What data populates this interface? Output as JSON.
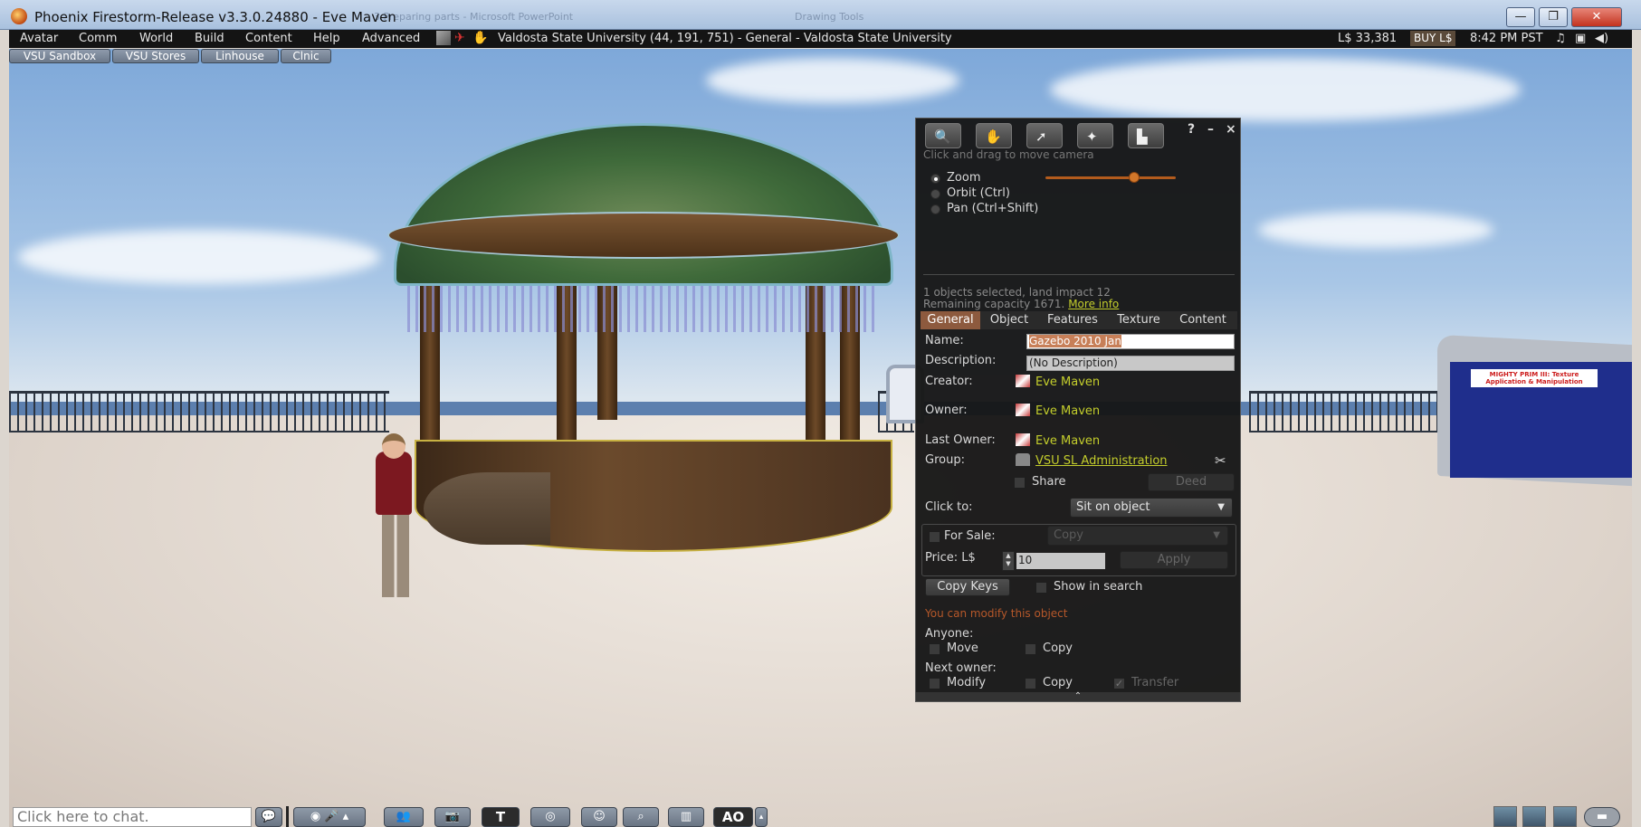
{
  "window": {
    "title": "Phoenix Firestorm-Release v3.3.0.24880 - Eve Maven",
    "ghost_title": "3 Preparing parts - Microsoft PowerPoint",
    "ghost_tab": "Drawing Tools",
    "minimize": "—",
    "maximize": "❐",
    "close": "✕"
  },
  "menu": {
    "items": [
      "Avatar",
      "Comm",
      "World",
      "Build",
      "Content",
      "Help",
      "Advanced"
    ],
    "location": "Valdosta State University (44, 191, 751) - General - Valdosta State University",
    "balance": "L$ 33,381",
    "buy_label": "BUY L$",
    "time": "8:42 PM PST",
    "status_icons": [
      "music-icon",
      "media-icon",
      "volume-icon"
    ]
  },
  "favorites": [
    "VSU Sandbox",
    "VSU Stores",
    "Linhouse",
    "Clnic"
  ],
  "scene": {
    "kiosk_title": "MIGHTY PRIM III: Texture Application & Manipulation"
  },
  "build_panel": {
    "header_controls": {
      "help": "?",
      "minimize": "–",
      "close": "×"
    },
    "tool_icons": [
      "focus-tool-icon",
      "move-tool-icon",
      "edit-tool-icon",
      "create-tool-icon",
      "land-tool-icon"
    ],
    "hint": "Click and drag to move camera",
    "camera_modes": [
      {
        "label": "Zoom",
        "selected": true
      },
      {
        "label": "Orbit (Ctrl)",
        "selected": false
      },
      {
        "label": "Pan (Ctrl+Shift)",
        "selected": false
      }
    ],
    "zoom_level": 0.68,
    "selection_info": "1 objects selected, land impact 12",
    "remaining": "Remaining capacity 1671.",
    "more_info": "More info",
    "tabs": [
      "General",
      "Object",
      "Features",
      "Texture",
      "Content"
    ],
    "active_tab": "General",
    "general": {
      "name_label": "Name:",
      "name_value": "Gazebo 2010 Jan",
      "description_label": "Description:",
      "description_value": "(No Description)",
      "creator_label": "Creator:",
      "creator": "Eve Maven",
      "owner_label": "Owner:",
      "owner": "Eve Maven",
      "last_owner_label": "Last Owner:",
      "last_owner": "Eve Maven",
      "group_label": "Group:",
      "group": "VSU SL Administration",
      "share_label": "Share",
      "deed_label": "Deed",
      "click_to_label": "Click to:",
      "click_to_value": "Sit on object",
      "for_sale_label": "For Sale:",
      "sale_type": "Copy",
      "price_label": "Price: L$",
      "price_value": "10",
      "apply_label": "Apply",
      "copy_keys_label": "Copy Keys",
      "show_in_search_label": "Show in search",
      "modify_note": "You can modify this object",
      "anyone_label": "Anyone:",
      "anyone_move": "Move",
      "anyone_copy": "Copy",
      "next_owner_label": "Next owner:",
      "next_modify": "Modify",
      "next_copy": "Copy",
      "next_transfer": "Transfer",
      "transfer_checked": "✓",
      "collapse": "⌃"
    }
  },
  "bottom": {
    "chat_placeholder": "Click here to chat.",
    "ao_label": "AO",
    "up_arrow": "▴"
  },
  "colors": {
    "panel_bg": "#161616",
    "accent_orange": "#8d5a3e",
    "link_green": "#c4ce2c",
    "warning_orange": "#b6582a"
  }
}
